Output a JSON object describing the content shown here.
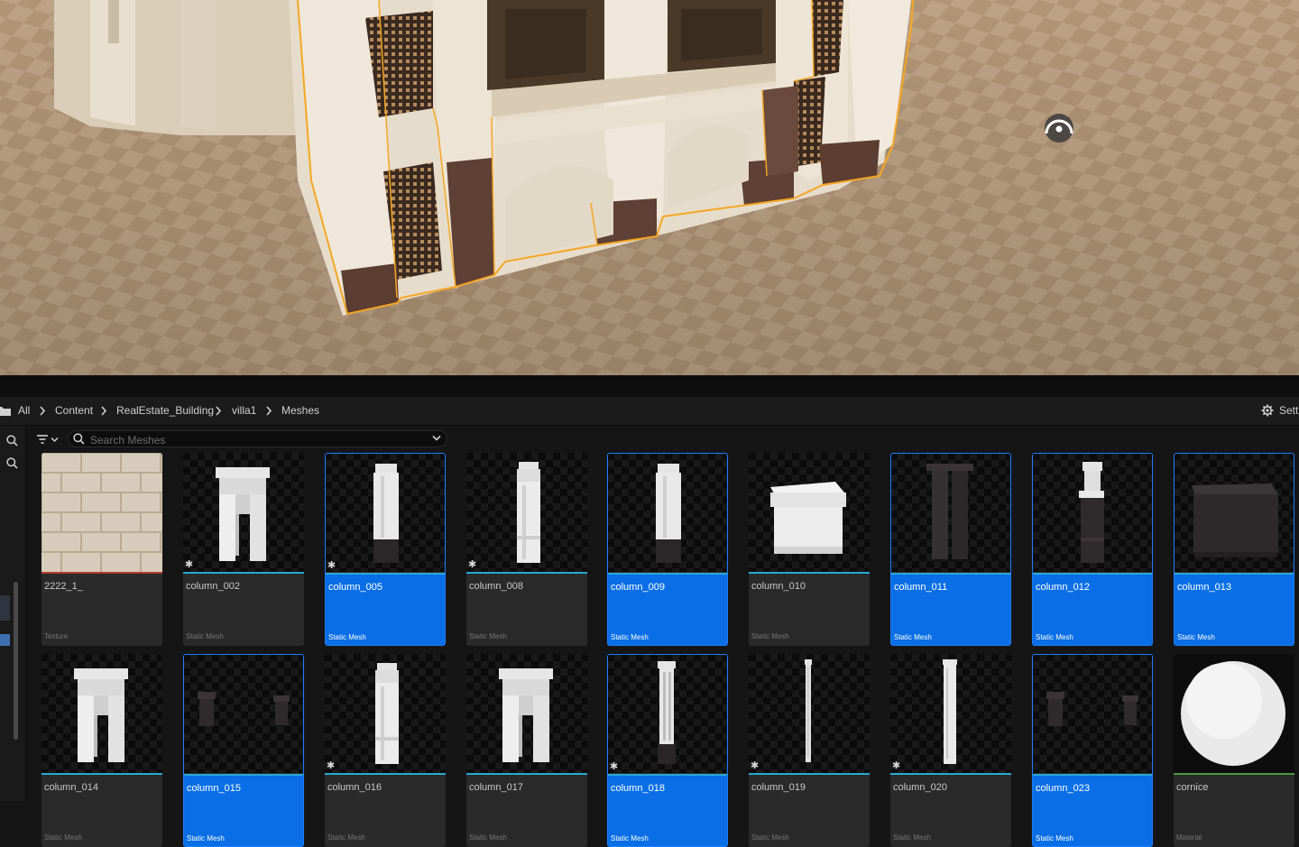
{
  "breadcrumb": {
    "items": [
      "All",
      "Content",
      "RealEstate_Building",
      "villa1",
      "Meshes"
    ],
    "settings_label": "Sett"
  },
  "search": {
    "placeholder": "Search Meshes",
    "value": ""
  },
  "assets": [
    {
      "name": "2222_1_",
      "type": "Texture",
      "selected": false,
      "starred": false,
      "thumb": "brick-texture"
    },
    {
      "name": "column_002",
      "type": "Static Mesh",
      "selected": false,
      "starred": true,
      "thumb": "arch-double-white"
    },
    {
      "name": "column_005",
      "type": "Static Mesh",
      "selected": true,
      "starred": true,
      "thumb": "pillar-white-dark-base"
    },
    {
      "name": "column_008",
      "type": "Static Mesh",
      "selected": false,
      "starred": true,
      "thumb": "pillar-white"
    },
    {
      "name": "column_009",
      "type": "Static Mesh",
      "selected": true,
      "starred": false,
      "thumb": "pillar-white-dark-base"
    },
    {
      "name": "column_010",
      "type": "Static Mesh",
      "selected": false,
      "starred": false,
      "thumb": "block-white"
    },
    {
      "name": "column_011",
      "type": "Static Mesh",
      "selected": true,
      "starred": false,
      "thumb": "pillar-double-dark"
    },
    {
      "name": "column_012",
      "type": "Static Mesh",
      "selected": true,
      "starred": false,
      "thumb": "pillar-white-top-dark"
    },
    {
      "name": "column_013",
      "type": "Static Mesh",
      "selected": true,
      "starred": false,
      "thumb": "block-dark"
    },
    {
      "name": "column_014",
      "type": "Static Mesh",
      "selected": false,
      "starred": false,
      "thumb": "arch-double-white"
    },
    {
      "name": "column_015",
      "type": "Static Mesh",
      "selected": true,
      "starred": false,
      "thumb": "two-small-dark"
    },
    {
      "name": "column_016",
      "type": "Static Mesh",
      "selected": false,
      "starred": true,
      "thumb": "pillar-white"
    },
    {
      "name": "column_017",
      "type": "Static Mesh",
      "selected": false,
      "starred": false,
      "thumb": "arch-double-white"
    },
    {
      "name": "column_018",
      "type": "Static Mesh",
      "selected": true,
      "starred": true,
      "thumb": "pillar-thin-dark-base"
    },
    {
      "name": "column_019",
      "type": "Static Mesh",
      "selected": false,
      "starred": true,
      "thumb": "pillar-very-thin"
    },
    {
      "name": "column_020",
      "type": "Static Mesh",
      "selected": false,
      "starred": true,
      "thumb": "pillar-thin-white"
    },
    {
      "name": "column_023",
      "type": "Static Mesh",
      "selected": true,
      "starred": false,
      "thumb": "two-small-dark"
    },
    {
      "name": "cornice",
      "type": "Material",
      "selected": false,
      "starred": false,
      "thumb": "sphere-white"
    }
  ],
  "colors": {
    "selection": "#0a6fe6",
    "static_mesh_line": "#29a9d4",
    "texture_line": "#b7382e",
    "material_line": "#4c9a3f",
    "selection_outline": "#f5a623"
  },
  "icons": {
    "folder": "folder-icon",
    "chevron": "chevron-right-icon",
    "settings": "gear-icon",
    "search": "search-icon",
    "filter": "filter-icon",
    "dropdown": "chevron-down-icon",
    "favorite": "star-icon"
  }
}
